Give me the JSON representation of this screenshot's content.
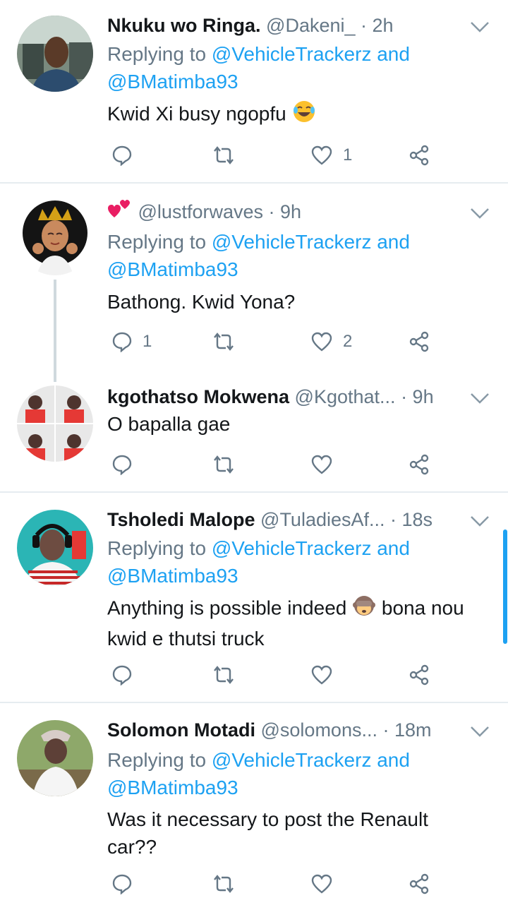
{
  "tweets": [
    {
      "name": "Nkuku wo Ringa.",
      "handle": "@Dakeni_",
      "time": "· 2h",
      "replying_prefix": "Replying to ",
      "replying_mention1": "@VehicleTrackerz",
      "replying_and": " and",
      "replying_mention2": "@BMatimba93",
      "text": "Kwid Xi busy ngopfu",
      "text_emoji": "joy",
      "reply_count": "",
      "retweet_count": "",
      "like_count": "1"
    },
    {
      "name": "",
      "name_emoji": "two-hearts",
      "handle": "@lustforwaves",
      "time": "· 9h",
      "replying_prefix": "Replying to ",
      "replying_mention1": "@VehicleTrackerz",
      "replying_and": " and",
      "replying_mention2": "@BMatimba93",
      "text": "Bathong. Kwid Yona?",
      "reply_count": "1",
      "retweet_count": "",
      "like_count": "2"
    },
    {
      "name": "kgothatso Mokwena",
      "handle": "@Kgothat...",
      "time": "· 9h",
      "text": "O bapalla gae",
      "reply_count": "",
      "retweet_count": "",
      "like_count": ""
    },
    {
      "name": "Tsholedi Malope",
      "handle": "@TuladiesAf...",
      "time": "· 18s",
      "replying_prefix": "Replying to ",
      "replying_mention1": "@VehicleTrackerz",
      "replying_and": " and",
      "replying_mention2": "@BMatimba93",
      "text_line1_a": "Anything is possible indeed",
      "text_line1_emoji": "see-no-evil-monkey",
      "text_line1_b": "bona nou",
      "text_line2": "kwid e thutsi truck",
      "reply_count": "",
      "retweet_count": "",
      "like_count": ""
    },
    {
      "name": "Solomon Motadi",
      "handle": "@solomons...",
      "time": "· 18m",
      "replying_prefix": "Replying to ",
      "replying_mention1": "@VehicleTrackerz",
      "replying_and": " and",
      "replying_mention2": "@BMatimba93",
      "text_line1": "Was it necessary to post the Renault",
      "text_line2": "car??"
    }
  ],
  "colors": {
    "link": "#1da1f2",
    "secondary": "#657786",
    "primary": "#14171a",
    "divider": "#e6ecf0"
  },
  "icons": [
    "reply-icon",
    "retweet-icon",
    "like-icon",
    "share-icon",
    "chevron-down-icon"
  ]
}
